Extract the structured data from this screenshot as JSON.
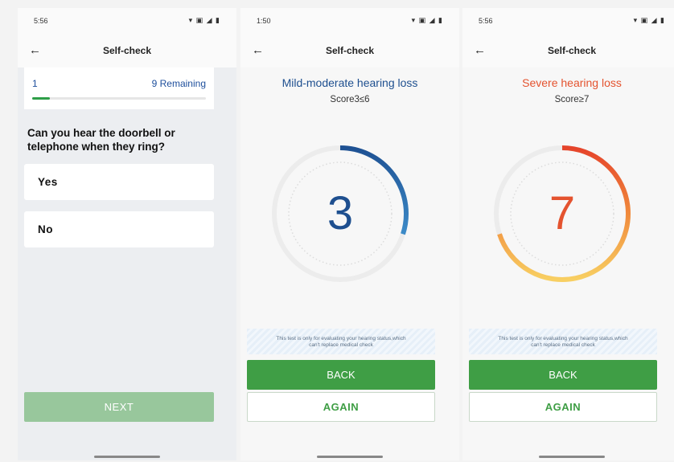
{
  "screens": [
    {
      "status_time": "5:56",
      "status_icons": "▾ ▣ ◢ ▮",
      "app_title": "Self-check",
      "progress": {
        "current": "1",
        "remaining": "9 Remaining",
        "fraction": 0.1
      },
      "question": "Can you hear the doorbell or telephone when they ring?",
      "options": [
        "Yes",
        "No"
      ],
      "next_label": "NEXT"
    },
    {
      "status_time": "1:50",
      "status_icons": "▾ ▣ ◢ ▮",
      "app_title": "Self-check",
      "result_title": "Mild-moderate hearing loss",
      "score_range": "Score3≤6",
      "score": "3",
      "gauge_fraction": 0.3,
      "accent": "#1e5c9e",
      "disclaimer_line1": "This test is only for evaluating your hearing status,which",
      "disclaimer_line2": "can't replace medical check",
      "back_label": "BACK",
      "again_label": "AGAIN"
    },
    {
      "status_time": "5:56",
      "status_icons": "▾ ▣ ◢ ▮",
      "app_title": "Self-check",
      "result_title": "Severe hearing loss",
      "score_range": "Score≥7",
      "score": "7",
      "gauge_fraction": 0.7,
      "accent": "#e4532f",
      "disclaimer_line1": "This test is only for evaluating your hearing status,which",
      "disclaimer_line2": "can't replace medical check",
      "back_label": "BACK",
      "again_label": "AGAIN"
    }
  ],
  "icons": {
    "back": "arrow-left-icon"
  }
}
